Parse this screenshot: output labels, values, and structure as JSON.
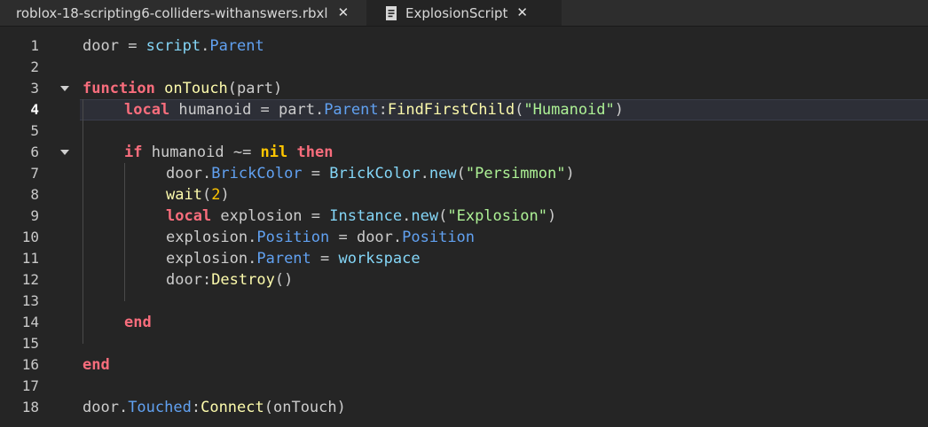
{
  "tabs": [
    {
      "label": "roblox-18-scripting6-colliders-withanswers.rbxl",
      "icon": "none",
      "active": false
    },
    {
      "label": "ExplosionScript",
      "icon": "script-doc-icon",
      "active": true
    }
  ],
  "close_glyph": "✕",
  "active_line": 4,
  "line_numbers": [
    "1",
    "2",
    "3",
    "4",
    "5",
    "6",
    "7",
    "8",
    "9",
    "10",
    "11",
    "12",
    "13",
    "14",
    "15",
    "16",
    "17",
    "18"
  ],
  "code": {
    "l1": {
      "a": "door",
      "b": " = ",
      "c": "script",
      "d": ".",
      "e": "Parent"
    },
    "l3": {
      "a": "function",
      "b": " ",
      "c": "onTouch",
      "d": "(part)"
    },
    "l4": {
      "a": "local",
      "b": " humanoid = part.",
      "c": "Parent",
      "d": ":",
      "e": "FindFirstChild",
      "f": "(",
      "g": "\"Humanoid\"",
      "h": ")"
    },
    "l6": {
      "a": "if",
      "b": " humanoid ~= ",
      "c": "nil",
      "d": " ",
      "e": "then"
    },
    "l7": {
      "a": "door.",
      "b": "BrickColor",
      "c": " = ",
      "d": "BrickColor",
      "e": ".",
      "f": "new",
      "g": "(",
      "h": "\"Persimmon\"",
      "i": ")"
    },
    "l8": {
      "a": "wait",
      "b": "(",
      "c": "2",
      "d": ")"
    },
    "l9": {
      "a": "local",
      "b": " explosion = ",
      "c": "Instance",
      "d": ".",
      "e": "new",
      "f": "(",
      "g": "\"Explosion\"",
      "h": ")"
    },
    "l10": {
      "a": "explosion.",
      "b": "Position",
      "c": " = door.",
      "d": "Position"
    },
    "l11": {
      "a": "explosion.",
      "b": "Parent",
      "c": " = ",
      "d": "workspace"
    },
    "l12": {
      "a": "door:",
      "b": "Destroy",
      "c": "()"
    },
    "l14": {
      "a": "end"
    },
    "l16": {
      "a": "end"
    },
    "l18": {
      "a": "door.",
      "b": "Touched",
      "c": ":",
      "d": "Connect",
      "e": "(onTouch)"
    }
  }
}
